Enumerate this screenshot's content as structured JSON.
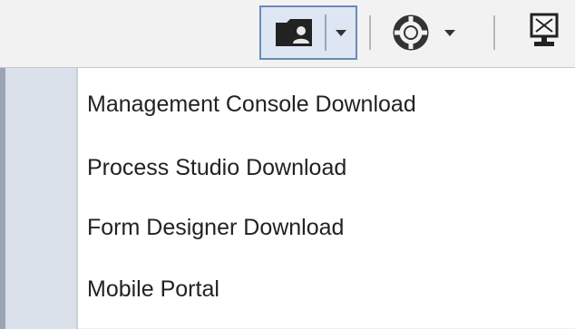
{
  "toolbar": {
    "buttons": [
      {
        "icon": "folder-person-icon",
        "has_dropdown": true,
        "active": true
      },
      {
        "icon": "lifebuoy-icon",
        "has_dropdown": true,
        "active": false
      },
      {
        "icon": "presentation-screen-icon",
        "has_dropdown": false,
        "active": false
      }
    ],
    "active_border_color": "#6a8ab8",
    "active_background_color": "#dde6f2"
  },
  "menu": {
    "items": [
      {
        "label": "Management Console Download"
      },
      {
        "label": "Process Studio Download"
      },
      {
        "label": "Form Designer Download"
      },
      {
        "label": "Mobile Portal"
      }
    ],
    "gutter_color": "#dbe1ea"
  }
}
